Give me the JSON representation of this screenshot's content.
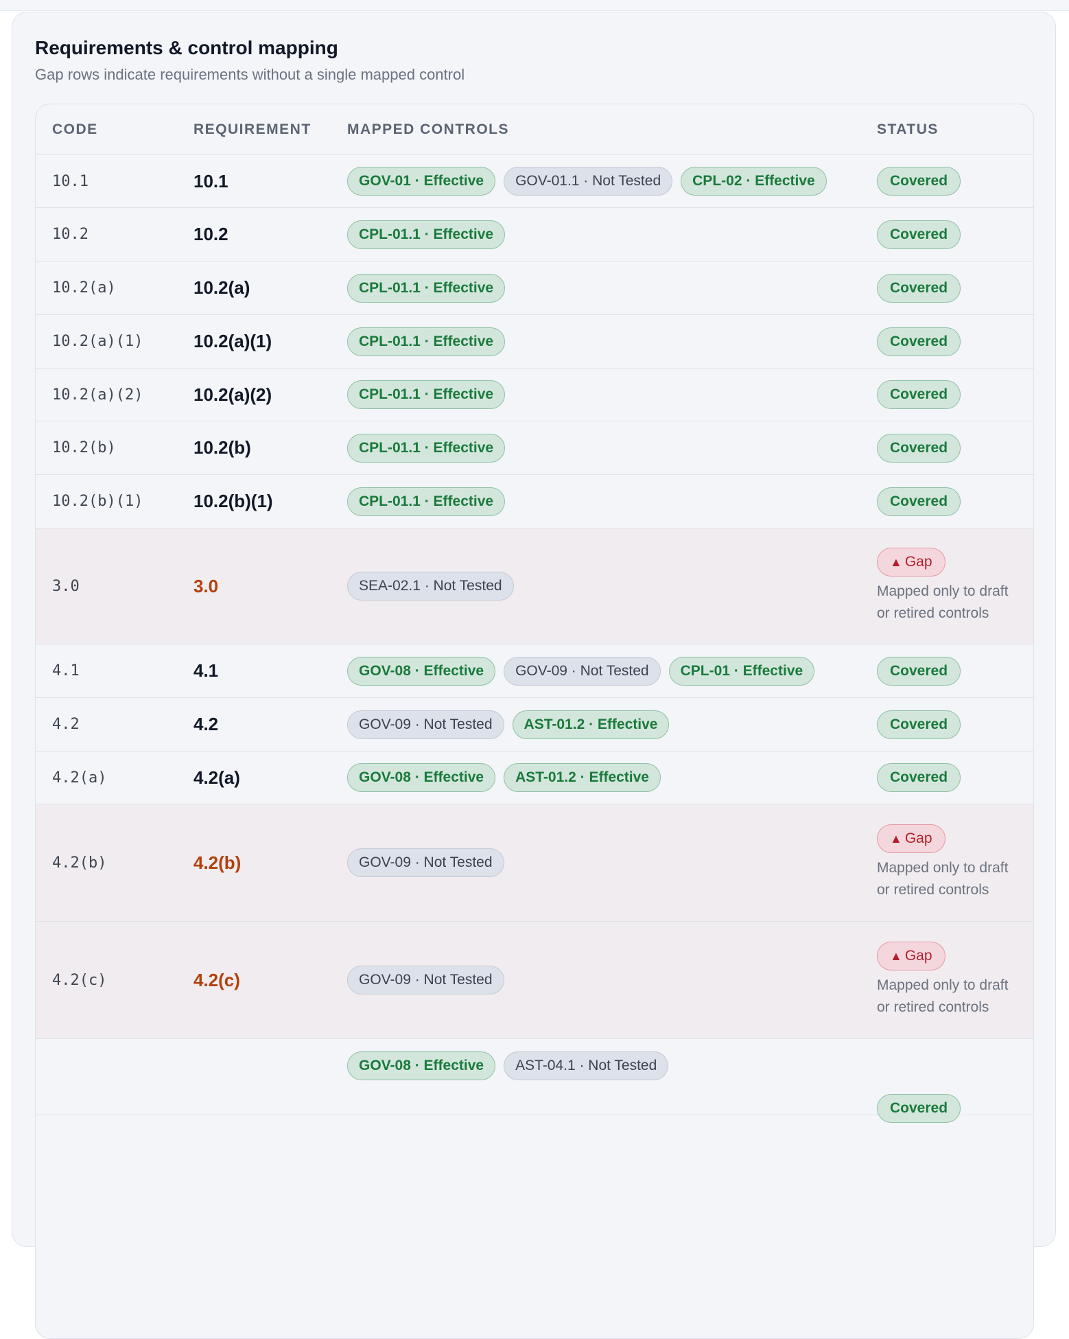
{
  "card": {
    "title": "Requirements & control mapping",
    "subtitle": "Gap rows indicate requirements without a single mapped control"
  },
  "columns": [
    "CODE",
    "REQUIREMENT",
    "MAPPED CONTROLS",
    "STATUS"
  ],
  "status_labels": {
    "covered": "Covered",
    "gap": "Gap"
  },
  "gap_note": "Mapped only to draft or retired controls",
  "rows": [
    {
      "code": "10.1",
      "requirement": "10.1",
      "status": "covered",
      "controls": [
        {
          "label": "GOV-01 · Effective",
          "state": "effective"
        },
        {
          "label": "GOV-01.1 · Not Tested",
          "state": "not_tested"
        },
        {
          "label": "CPL-02 · Effective",
          "state": "effective"
        }
      ]
    },
    {
      "code": "10.2",
      "requirement": "10.2",
      "status": "covered",
      "controls": [
        {
          "label": "CPL-01.1 · Effective",
          "state": "effective"
        }
      ]
    },
    {
      "code": "10.2(a)",
      "requirement": "10.2(a)",
      "status": "covered",
      "controls": [
        {
          "label": "CPL-01.1 · Effective",
          "state": "effective"
        }
      ]
    },
    {
      "code": "10.2(a)(1)",
      "requirement": "10.2(a)(1)",
      "status": "covered",
      "controls": [
        {
          "label": "CPL-01.1 · Effective",
          "state": "effective"
        }
      ]
    },
    {
      "code": "10.2(a)(2)",
      "requirement": "10.2(a)(2)",
      "status": "covered",
      "controls": [
        {
          "label": "CPL-01.1 · Effective",
          "state": "effective"
        }
      ]
    },
    {
      "code": "10.2(b)",
      "requirement": "10.2(b)",
      "status": "covered",
      "controls": [
        {
          "label": "CPL-01.1 · Effective",
          "state": "effective"
        }
      ]
    },
    {
      "code": "10.2(b)(1)",
      "requirement": "10.2(b)(1)",
      "status": "covered",
      "controls": [
        {
          "label": "CPL-01.1 · Effective",
          "state": "effective"
        }
      ]
    },
    {
      "code": "3.0",
      "requirement": "3.0",
      "status": "gap",
      "controls": [
        {
          "label": "SEA-02.1 · Not Tested",
          "state": "not_tested"
        }
      ]
    },
    {
      "code": "4.1",
      "requirement": "4.1",
      "status": "covered",
      "controls": [
        {
          "label": "GOV-08 · Effective",
          "state": "effective"
        },
        {
          "label": "GOV-09 · Not Tested",
          "state": "not_tested"
        },
        {
          "label": "CPL-01 · Effective",
          "state": "effective"
        }
      ]
    },
    {
      "code": "4.2",
      "requirement": "4.2",
      "status": "covered",
      "controls": [
        {
          "label": "GOV-09 · Not Tested",
          "state": "not_tested"
        },
        {
          "label": "AST-01.2 · Effective",
          "state": "effective"
        }
      ]
    },
    {
      "code": "4.2(a)",
      "requirement": "4.2(a)",
      "status": "covered",
      "controls": [
        {
          "label": "GOV-08 · Effective",
          "state": "effective"
        },
        {
          "label": "AST-01.2 · Effective",
          "state": "effective"
        }
      ]
    },
    {
      "code": "4.2(b)",
      "requirement": "4.2(b)",
      "status": "gap",
      "controls": [
        {
          "label": "GOV-09 · Not Tested",
          "state": "not_tested"
        }
      ]
    },
    {
      "code": "4.2(c)",
      "requirement": "4.2(c)",
      "status": "gap",
      "controls": [
        {
          "label": "GOV-09 · Not Tested",
          "state": "not_tested"
        }
      ]
    },
    {
      "code": "",
      "requirement": "",
      "status": "covered",
      "controls": [
        {
          "label": "GOV-08 · Effective",
          "state": "effective"
        },
        {
          "label": "AST-04.1 · Not Tested",
          "state": "not_tested"
        }
      ]
    }
  ],
  "colors": {
    "effective": "#1a7a3c",
    "not_tested": "#3b4250",
    "gap": "#b21f2d",
    "gap_requirement": "#b2410c",
    "gap_row_bg": "#f1ecef"
  }
}
